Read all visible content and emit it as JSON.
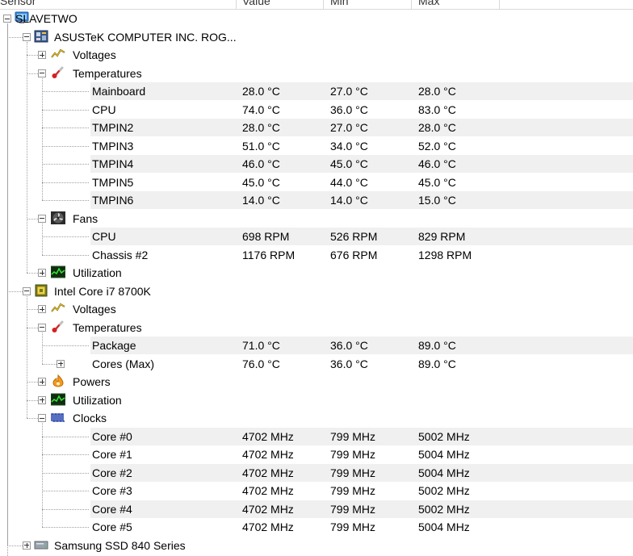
{
  "columns": [
    "Sensor",
    "Value",
    "Min",
    "Max"
  ],
  "rows": [
    {
      "label": "SLAVETWO",
      "level": 0,
      "expander": "minus",
      "icon": "computer-icon"
    },
    {
      "label": "ASUSTeK COMPUTER INC. ROG...",
      "level": 1,
      "expander": "minus",
      "icon": "motherboard-icon"
    },
    {
      "label": "Voltages",
      "level": 2,
      "expander": "plus",
      "icon": "voltage-icon"
    },
    {
      "label": "Temperatures",
      "level": 2,
      "expander": "minus",
      "icon": "thermometer-icon"
    },
    {
      "label": "Mainboard",
      "level": 3,
      "value": "28.0 °C",
      "min": "27.0 °C",
      "max": "28.0 °C"
    },
    {
      "label": "CPU",
      "level": 3,
      "value": "74.0 °C",
      "min": "36.0 °C",
      "max": "83.0 °C"
    },
    {
      "label": "TMPIN2",
      "level": 3,
      "value": "28.0 °C",
      "min": "27.0 °C",
      "max": "28.0 °C"
    },
    {
      "label": "TMPIN3",
      "level": 3,
      "value": "51.0 °C",
      "min": "34.0 °C",
      "max": "52.0 °C"
    },
    {
      "label": "TMPIN4",
      "level": 3,
      "value": "46.0 °C",
      "min": "45.0 °C",
      "max": "46.0 °C"
    },
    {
      "label": "TMPIN5",
      "level": 3,
      "value": "45.0 °C",
      "min": "44.0 °C",
      "max": "45.0 °C"
    },
    {
      "label": "TMPIN6",
      "level": 3,
      "value": "14.0 °C",
      "min": "14.0 °C",
      "max": "15.0 °C"
    },
    {
      "label": "Fans",
      "level": 2,
      "expander": "minus",
      "icon": "fan-icon"
    },
    {
      "label": "CPU",
      "level": 3,
      "value": "698 RPM",
      "min": "526 RPM",
      "max": "829 RPM"
    },
    {
      "label": "Chassis #2",
      "level": 3,
      "value": "1176 RPM",
      "min": "676 RPM",
      "max": "1298 RPM"
    },
    {
      "label": "Utilization",
      "level": 2,
      "expander": "plus",
      "icon": "utilization-icon"
    },
    {
      "label": "Intel Core i7 8700K",
      "level": 1,
      "expander": "minus",
      "icon": "cpu-chip-icon"
    },
    {
      "label": "Voltages",
      "level": 2,
      "expander": "plus",
      "icon": "voltage-icon"
    },
    {
      "label": "Temperatures",
      "level": 2,
      "expander": "minus",
      "icon": "thermometer-icon"
    },
    {
      "label": "Package",
      "level": 3,
      "value": "71.0 °C",
      "min": "36.0 °C",
      "max": "89.0 °C"
    },
    {
      "label": "Cores (Max)",
      "level": 3,
      "expander": "plus",
      "value": "76.0 °C",
      "min": "36.0 °C",
      "max": "89.0 °C"
    },
    {
      "label": "Powers",
      "level": 2,
      "expander": "plus",
      "icon": "power-icon"
    },
    {
      "label": "Utilization",
      "level": 2,
      "expander": "plus",
      "icon": "utilization-icon"
    },
    {
      "label": "Clocks",
      "level": 2,
      "expander": "minus",
      "icon": "clock-icon"
    },
    {
      "label": "Core #0",
      "level": 3,
      "value": "4702 MHz",
      "min": "799 MHz",
      "max": "5002 MHz"
    },
    {
      "label": "Core #1",
      "level": 3,
      "value": "4702 MHz",
      "min": "799 MHz",
      "max": "5004 MHz"
    },
    {
      "label": "Core #2",
      "level": 3,
      "value": "4702 MHz",
      "min": "799 MHz",
      "max": "5004 MHz"
    },
    {
      "label": "Core #3",
      "level": 3,
      "value": "4702 MHz",
      "min": "799 MHz",
      "max": "5002 MHz"
    },
    {
      "label": "Core #4",
      "level": 3,
      "value": "4702 MHz",
      "min": "799 MHz",
      "max": "5002 MHz"
    },
    {
      "label": "Core #5",
      "level": 3,
      "value": "4702 MHz",
      "min": "799 MHz",
      "max": "5004 MHz"
    },
    {
      "label": "Samsung SSD 840 Series",
      "level": 1,
      "expander": "plus",
      "icon": "disk-icon"
    }
  ]
}
